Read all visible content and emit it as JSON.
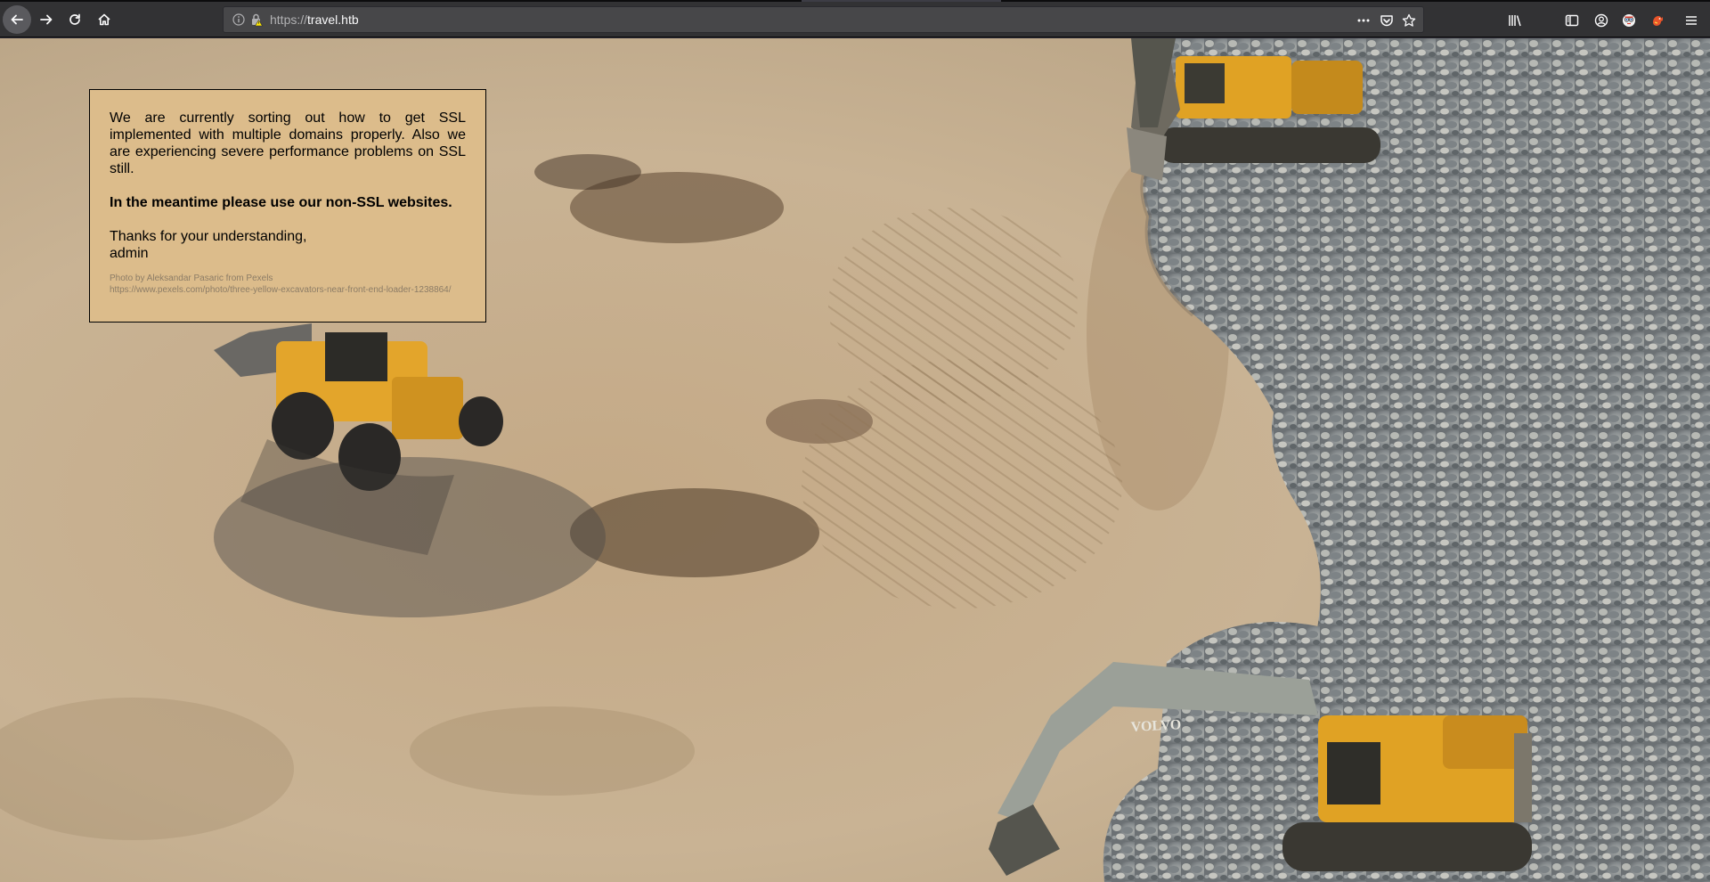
{
  "browser": {
    "url_scheme": "https://",
    "url_host": "travel.htb",
    "icons": {
      "back": "arrow-left-icon",
      "forward": "arrow-right-icon",
      "reload": "reload-icon",
      "home": "home-icon",
      "info": "info-icon",
      "lock": "insecure-lock-icon",
      "page_actions": "more-dots-icon",
      "pocket": "pocket-icon",
      "bookmark": "star-icon",
      "library": "library-icon",
      "sidebar": "sidebar-icon",
      "account": "account-icon",
      "extension_1": "extension-icon",
      "extension_2": "extension-icon",
      "menu": "hamburger-menu-icon"
    }
  },
  "notice": {
    "paragraph1": "We are currently sorting out how to get SSL implemented with multiple domains properly. Also we are experiencing severe performance problems on SSL still.",
    "paragraph2": "In the meantime please use our non-SSL websites.",
    "thanks": "Thanks for your understanding,",
    "signature": "admin",
    "credit_line1": "Photo by Aleksandar Pasaric from Pexels",
    "credit_line2": "https://www.pexels.com/photo/three-yellow-excavators-near-front-end-loader-1238864/"
  },
  "background": {
    "description_icon": "construction-site-photo",
    "colors": {
      "ground": "#c9b290",
      "gravel": "#8e9396",
      "machine_yellow": "#e0a224"
    }
  }
}
